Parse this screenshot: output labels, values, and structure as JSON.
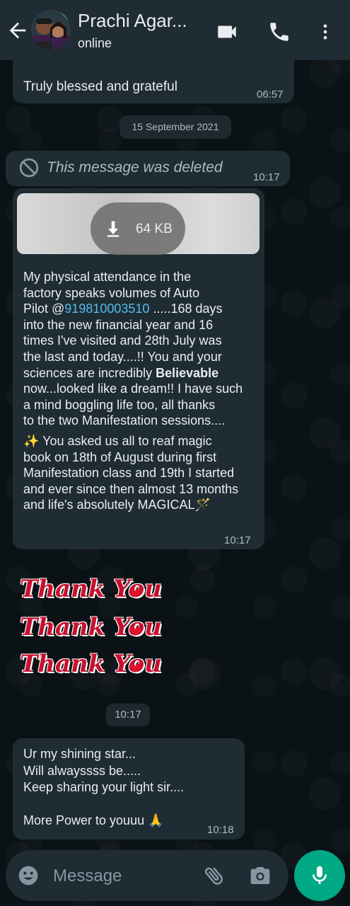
{
  "header": {
    "contact_name": "Prachi Agar...",
    "status": "online"
  },
  "messages": {
    "m1": {
      "text": "Truly blessed and grateful",
      "time": "06:57"
    },
    "date_chip": "15 September 2021",
    "m2": {
      "text": "This message was deleted",
      "time": "10:17"
    },
    "m3": {
      "file_size": "64 KB",
      "lines": {
        "l1": "My physical attendance in the",
        "l2": "factory speaks volumes of Auto",
        "l3_prefix": "Pilot @",
        "l3_link": "919810003510",
        "l3_suffix": " .....168 days",
        "l4": "into the new financial year and 16",
        "l5": "times I've visited and 28th July was",
        "l6": "the last and today....!! You and your",
        "l7_prefix": "sciences are incredibly ",
        "l7_bold": "Believable",
        "l8": "now...looked like a dream!! I have such",
        "l9": "a mind boggling life too, all thanks",
        "l10": "to the two Manifestation sessions....",
        "l11": "✨ You asked us all to reaf magic",
        "l12": "book on 18th of August during first",
        "l13": "Manifestation class and 19th I started",
        "l14": "and ever since then almost 13 months",
        "l15": "and life's absolutely MAGICAL🪄"
      },
      "time": "10:17"
    },
    "sticker": {
      "line1": "Thank You",
      "line2": "Thank You",
      "line3": "Thank You",
      "time": "10:17"
    },
    "m4": {
      "text": "Ur my shining star...\nWill alwayssss be.....\nKeep sharing your light sir....\n\nMore Power to youuu 🙏",
      "time": "10:18"
    }
  },
  "composer": {
    "placeholder": "Message"
  },
  "colors": {
    "header_bg": "#1f2c33",
    "bubble_bg": "#1f2c33",
    "accent": "#00a884",
    "link": "#53bdeb",
    "sticker_red": "#c8102e"
  }
}
